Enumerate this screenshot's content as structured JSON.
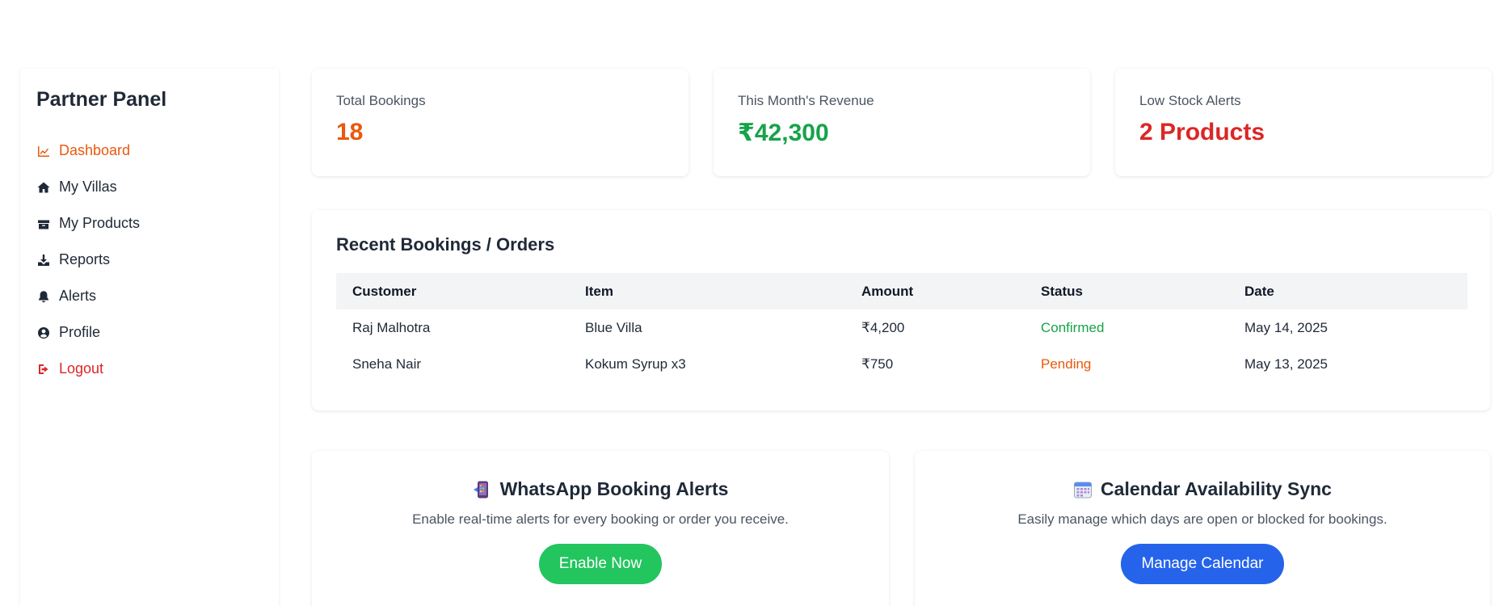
{
  "sidebar": {
    "title": "Partner Panel",
    "items": [
      {
        "label": "Dashboard",
        "icon": "chart-line-icon"
      },
      {
        "label": "My Villas",
        "icon": "home-icon"
      },
      {
        "label": "My Products",
        "icon": "box-icon"
      },
      {
        "label": "Reports",
        "icon": "download-icon"
      },
      {
        "label": "Alerts",
        "icon": "bell-icon"
      },
      {
        "label": "Profile",
        "icon": "user-circle-icon"
      },
      {
        "label": "Logout",
        "icon": "logout-icon"
      }
    ]
  },
  "stats": [
    {
      "label": "Total Bookings",
      "value": "18",
      "color": "#ea580c"
    },
    {
      "label": "This Month's Revenue",
      "value": "₹42,300",
      "color": "#16a34a"
    },
    {
      "label": "Low Stock Alerts",
      "value": "2 Products",
      "color": "#dc2626"
    }
  ],
  "bookings": {
    "title": "Recent Bookings / Orders",
    "headers": [
      "Customer",
      "Item",
      "Amount",
      "Status",
      "Date"
    ],
    "rows": [
      {
        "customer": "Raj Malhotra",
        "item": "Blue Villa",
        "amount": "₹4,200",
        "status": "Confirmed",
        "date": "May 14, 2025"
      },
      {
        "customer": "Sneha Nair",
        "item": "Kokum Syrup x3",
        "amount": "₹750",
        "status": "Pending",
        "date": "May 13, 2025"
      }
    ]
  },
  "features": [
    {
      "title": "WhatsApp Booking Alerts",
      "icon": "phone-icon",
      "desc": "Enable real-time alerts for every booking or order you receive.",
      "button": "Enable Now",
      "button_color": "#22c55e"
    },
    {
      "title": "Calendar Availability Sync",
      "icon": "calendar-icon",
      "desc": "Easily manage which days are open or blocked for bookings.",
      "button": "Manage Calendar",
      "button_color": "#2563eb"
    }
  ]
}
